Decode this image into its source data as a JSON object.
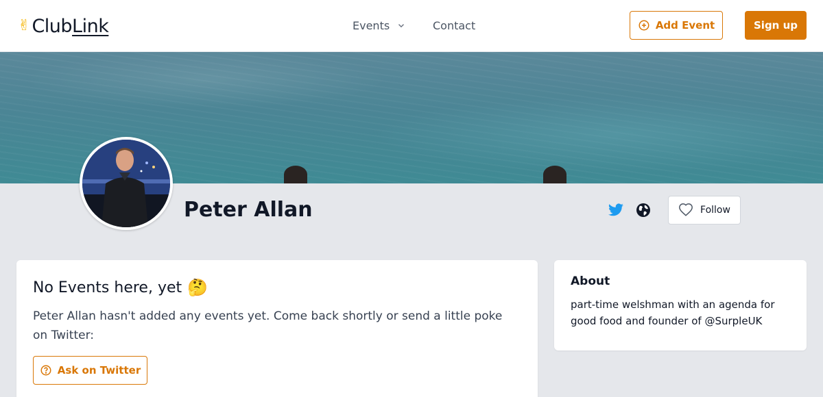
{
  "header": {
    "logo": {
      "icon": "victory-hand-icon",
      "icon_glyph": "✌",
      "club": "Club",
      "link": "Link"
    },
    "nav": {
      "events_label": "Events",
      "contact_label": "Contact"
    },
    "add_event_label": "Add Event",
    "signup_label": "Sign up"
  },
  "profile": {
    "name": "Peter Allan",
    "follow_label": "Follow",
    "social_icons": [
      "twitter-icon",
      "globe-icon"
    ]
  },
  "events_card": {
    "title": "No Events here, yet",
    "title_emoji": "🤔",
    "description": "Peter Allan hasn't added any events yet. Come back shortly or send a little poke on Twitter:",
    "ask_label": "Ask on Twitter"
  },
  "about_card": {
    "title": "About",
    "text": "part-time welshman with an agenda for good food and founder of @SurpleUK"
  },
  "colors": {
    "accent": "#d97706",
    "twitter": "#1d9bf0",
    "page_bg": "#e5e7eb",
    "card_bg": "#ffffff"
  }
}
